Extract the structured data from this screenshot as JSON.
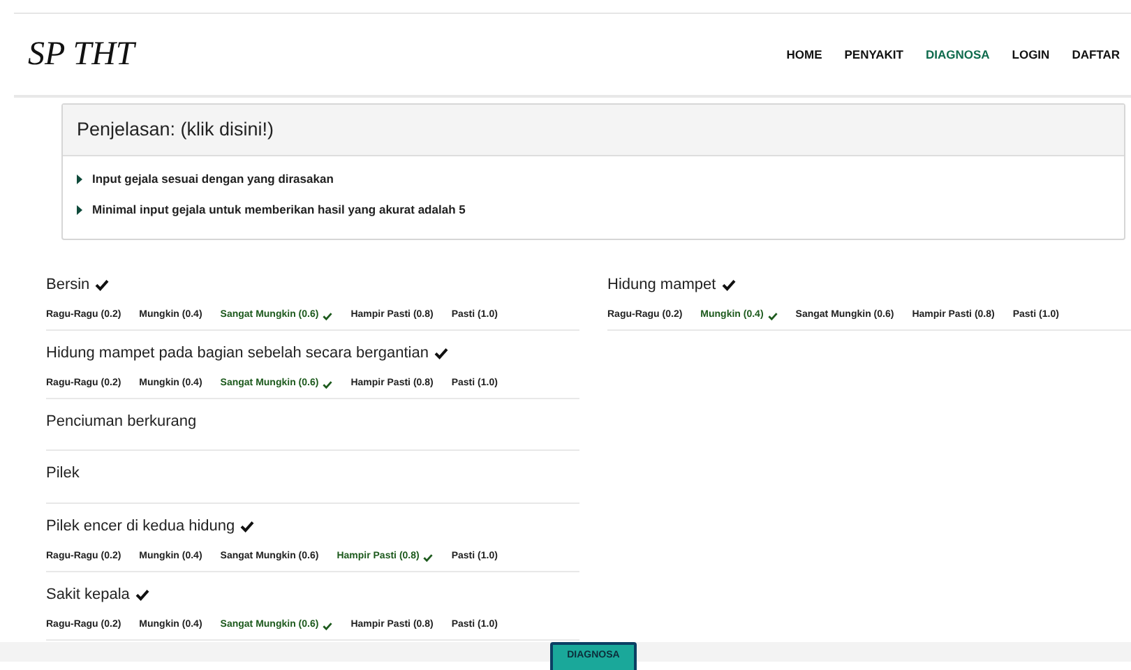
{
  "brand": "SP THT",
  "nav": [
    {
      "label": "HOME",
      "selected": false
    },
    {
      "label": "PENYAKIT",
      "selected": false
    },
    {
      "label": "DIAGNOSA",
      "selected": true
    },
    {
      "label": "LOGIN",
      "selected": false
    },
    {
      "label": "DAFTAR",
      "selected": false
    }
  ],
  "info_panel": {
    "title": "Penjelasan: (klik disini!)",
    "items": [
      "Input gejala sesuai dengan yang dirasakan",
      "Minimal input gejala untuk memberikan hasil yang akurat adalah 5"
    ]
  },
  "symptom_columns": [
    [
      {
        "name": "Bersin",
        "checked": true,
        "options": [
          {
            "label": "Ragu-Ragu (0.2)",
            "selected": false
          },
          {
            "label": "Mungkin (0.4)",
            "selected": false
          },
          {
            "label": "Sangat Mungkin (0.6)",
            "selected": true
          },
          {
            "label": "Hampir Pasti (0.8)",
            "selected": false
          },
          {
            "label": "Pasti (1.0)",
            "selected": false
          }
        ]
      },
      {
        "name": "Hidung mampet pada bagian sebelah secara bergantian",
        "checked": true,
        "options": [
          {
            "label": "Ragu-Ragu (0.2)",
            "selected": false
          },
          {
            "label": "Mungkin (0.4)",
            "selected": false
          },
          {
            "label": "Sangat Mungkin (0.6)",
            "selected": true
          },
          {
            "label": "Hampir Pasti (0.8)",
            "selected": false
          },
          {
            "label": "Pasti (1.0)",
            "selected": false
          }
        ]
      },
      {
        "name": "Penciuman berkurang",
        "checked": false
      },
      {
        "name": "Pilek",
        "checked": false
      },
      {
        "name": "Pilek encer di kedua hidung",
        "checked": true,
        "options": [
          {
            "label": "Ragu-Ragu (0.2)",
            "selected": false
          },
          {
            "label": "Mungkin (0.4)",
            "selected": false
          },
          {
            "label": "Sangat Mungkin (0.6)",
            "selected": false
          },
          {
            "label": "Hampir Pasti (0.8)",
            "selected": true
          },
          {
            "label": "Pasti (1.0)",
            "selected": false
          }
        ]
      },
      {
        "name": "Sakit kepala",
        "checked": true,
        "options": [
          {
            "label": "Ragu-Ragu (0.2)",
            "selected": false
          },
          {
            "label": "Mungkin (0.4)",
            "selected": false
          },
          {
            "label": "Sangat Mungkin (0.6)",
            "selected": true
          },
          {
            "label": "Hampir Pasti (0.8)",
            "selected": false
          },
          {
            "label": "Pasti (1.0)",
            "selected": false
          }
        ]
      }
    ],
    [
      {
        "name": "Hidung mampet",
        "checked": true,
        "options": [
          {
            "label": "Ragu-Ragu (0.2)",
            "selected": false
          },
          {
            "label": "Mungkin (0.4)",
            "selected": true
          },
          {
            "label": "Sangat Mungkin (0.6)",
            "selected": false
          },
          {
            "label": "Hampir Pasti (0.8)",
            "selected": false
          },
          {
            "label": "Pasti (1.0)",
            "selected": false
          }
        ]
      }
    ]
  ],
  "submit_button": "DIAGNOSA"
}
